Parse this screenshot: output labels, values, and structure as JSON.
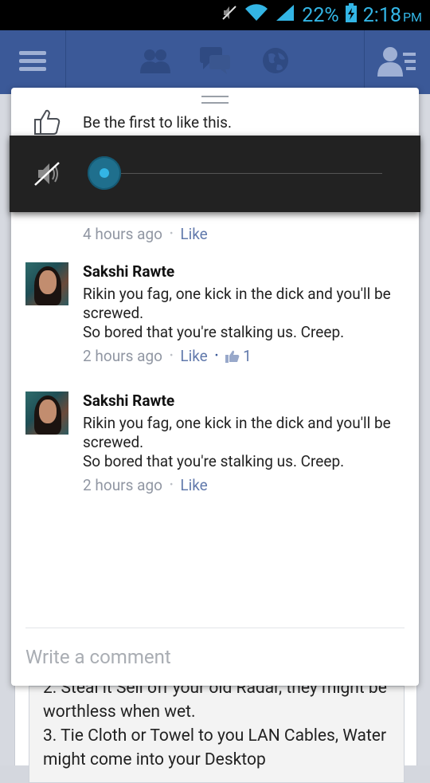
{
  "status_bar": {
    "battery_percent": "22%",
    "time": "2:18",
    "ampm": "PM"
  },
  "nav": {
    "icons": [
      "menu-icon",
      "friends-icon",
      "messages-icon",
      "globe-icon",
      "contacts-icon"
    ]
  },
  "like_banner": {
    "text": "Be the first to like this."
  },
  "volume": {
    "level": 0,
    "muted": true
  },
  "first_comment": {
    "time": "4 hours ago",
    "like_label": "Like"
  },
  "comments": [
    {
      "name": "Sakshi Rawte",
      "text": "Rikin you fag, one kick in the dick and you'll be screwed.\nSo bored that you're stalking us. Creep.",
      "time": "2 hours ago",
      "like_label": "Like",
      "likes": "1"
    },
    {
      "name": "Sakshi Rawte",
      "text": "Rikin you fag, one kick in the dick and you'll be screwed.\nSo bored that you're stalking us. Creep.",
      "time": "2 hours ago",
      "like_label": "Like"
    }
  ],
  "composer": {
    "placeholder": "Write a comment"
  },
  "background_post": {
    "text": "2. Steal it Sell off your old Radar, they might be worthless when wet.\n3. Tie Cloth or Towel to you LAN Cables, Water might come into your Desktop"
  },
  "colors": {
    "brand": "#3b5998",
    "status_accent": "#33b5e5"
  }
}
